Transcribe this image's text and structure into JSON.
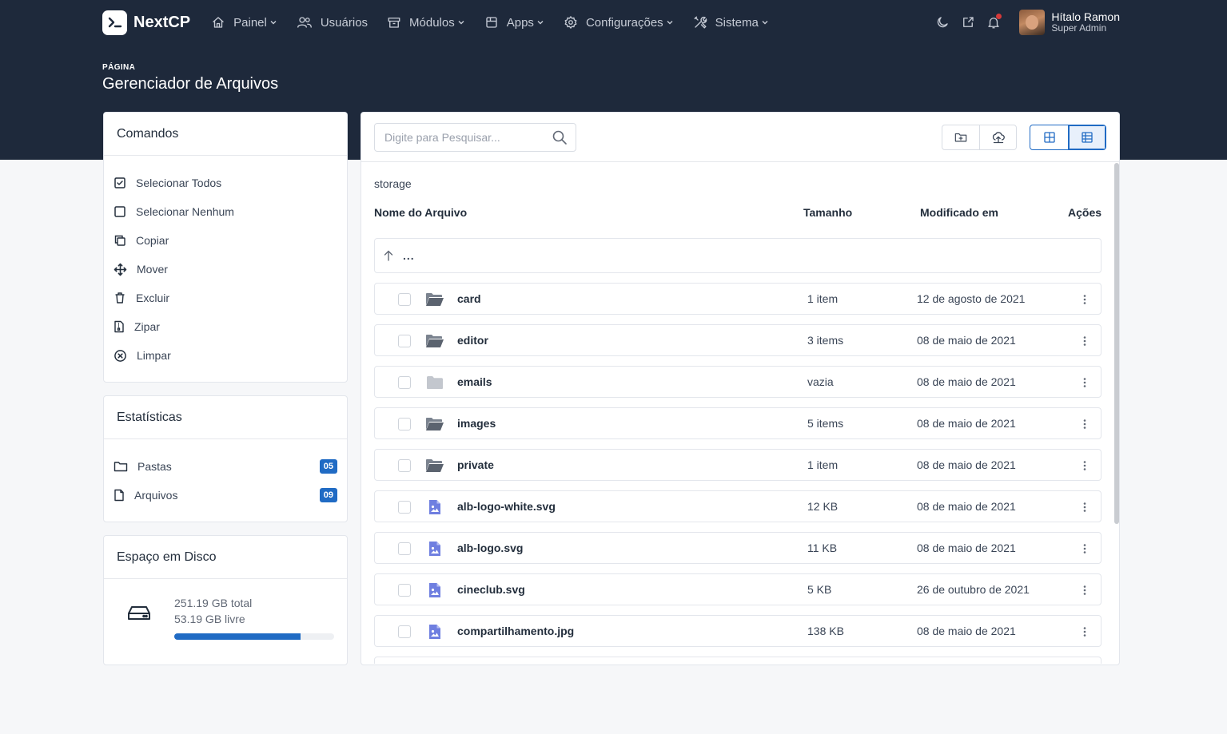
{
  "brand": {
    "name": "NextCP"
  },
  "nav": [
    {
      "label": "Painel",
      "icon": "home-icon",
      "dropdown": true
    },
    {
      "label": "Usuários",
      "icon": "users-icon",
      "dropdown": false
    },
    {
      "label": "Módulos",
      "icon": "box-icon",
      "dropdown": true
    },
    {
      "label": "Apps",
      "icon": "package-icon",
      "dropdown": true
    },
    {
      "label": "Configurações",
      "icon": "gear-icon",
      "dropdown": true
    },
    {
      "label": "Sistema",
      "icon": "tools-icon",
      "dropdown": true
    }
  ],
  "user": {
    "name": "Hítalo Ramon",
    "role": "Super Admin"
  },
  "page": {
    "pretitle": "PÁGINA",
    "title": "Gerenciador de Arquivos"
  },
  "commands": {
    "title": "Comandos",
    "items": [
      {
        "label": "Selecionar Todos",
        "icon": "checkbox-checked-icon"
      },
      {
        "label": "Selecionar Nenhum",
        "icon": "checkbox-empty-icon"
      },
      {
        "label": "Copiar",
        "icon": "copy-icon"
      },
      {
        "label": "Mover",
        "icon": "move-icon"
      },
      {
        "label": "Excluir",
        "icon": "trash-icon"
      },
      {
        "label": "Zipar",
        "icon": "zip-icon"
      },
      {
        "label": "Limpar",
        "icon": "clear-circle-icon"
      }
    ]
  },
  "stats": {
    "title": "Estatísticas",
    "items": [
      {
        "label": "Pastas",
        "count": "05",
        "icon": "folder-icon"
      },
      {
        "label": "Arquivos",
        "count": "09",
        "icon": "file-icon"
      }
    ]
  },
  "disk": {
    "title": "Espaço em Disco",
    "total": "251.19 GB total",
    "free": "53.19 GB livre",
    "used_fraction": 0.79
  },
  "search": {
    "placeholder": "Digite para Pesquisar..."
  },
  "path": "storage",
  "columns": {
    "name": "Nome do Arquivo",
    "size": "Tamanho",
    "modified": "Modificado em",
    "actions": "Ações"
  },
  "up_row": {
    "label": "..."
  },
  "files": [
    {
      "name": "card",
      "size": "1 item",
      "modified": "12 de agosto de 2021",
      "type": "folder-open"
    },
    {
      "name": "editor",
      "size": "3 items",
      "modified": "08 de maio de 2021",
      "type": "folder-open"
    },
    {
      "name": "emails",
      "size": "vazia",
      "modified": "08 de maio de 2021",
      "type": "folder-empty"
    },
    {
      "name": "images",
      "size": "5 items",
      "modified": "08 de maio de 2021",
      "type": "folder-open"
    },
    {
      "name": "private",
      "size": "1 item",
      "modified": "08 de maio de 2021",
      "type": "folder-open"
    },
    {
      "name": "alb-logo-white.svg",
      "size": "12 KB",
      "modified": "08 de maio de 2021",
      "type": "image"
    },
    {
      "name": "alb-logo.svg",
      "size": "11 KB",
      "modified": "08 de maio de 2021",
      "type": "image"
    },
    {
      "name": "cineclub.svg",
      "size": "5 KB",
      "modified": "26 de outubro de 2021",
      "type": "image"
    },
    {
      "name": "compartilhamento.jpg",
      "size": "138 KB",
      "modified": "08 de maio de 2021",
      "type": "image"
    },
    {
      "name": "",
      "size": "",
      "modified": "",
      "type": "image"
    }
  ],
  "colors": {
    "header_bg": "#1e293b",
    "accent": "#206bc4",
    "notification": "#d63939",
    "file_icon": "#6f7fe0",
    "folder_icon": "#626b78"
  }
}
